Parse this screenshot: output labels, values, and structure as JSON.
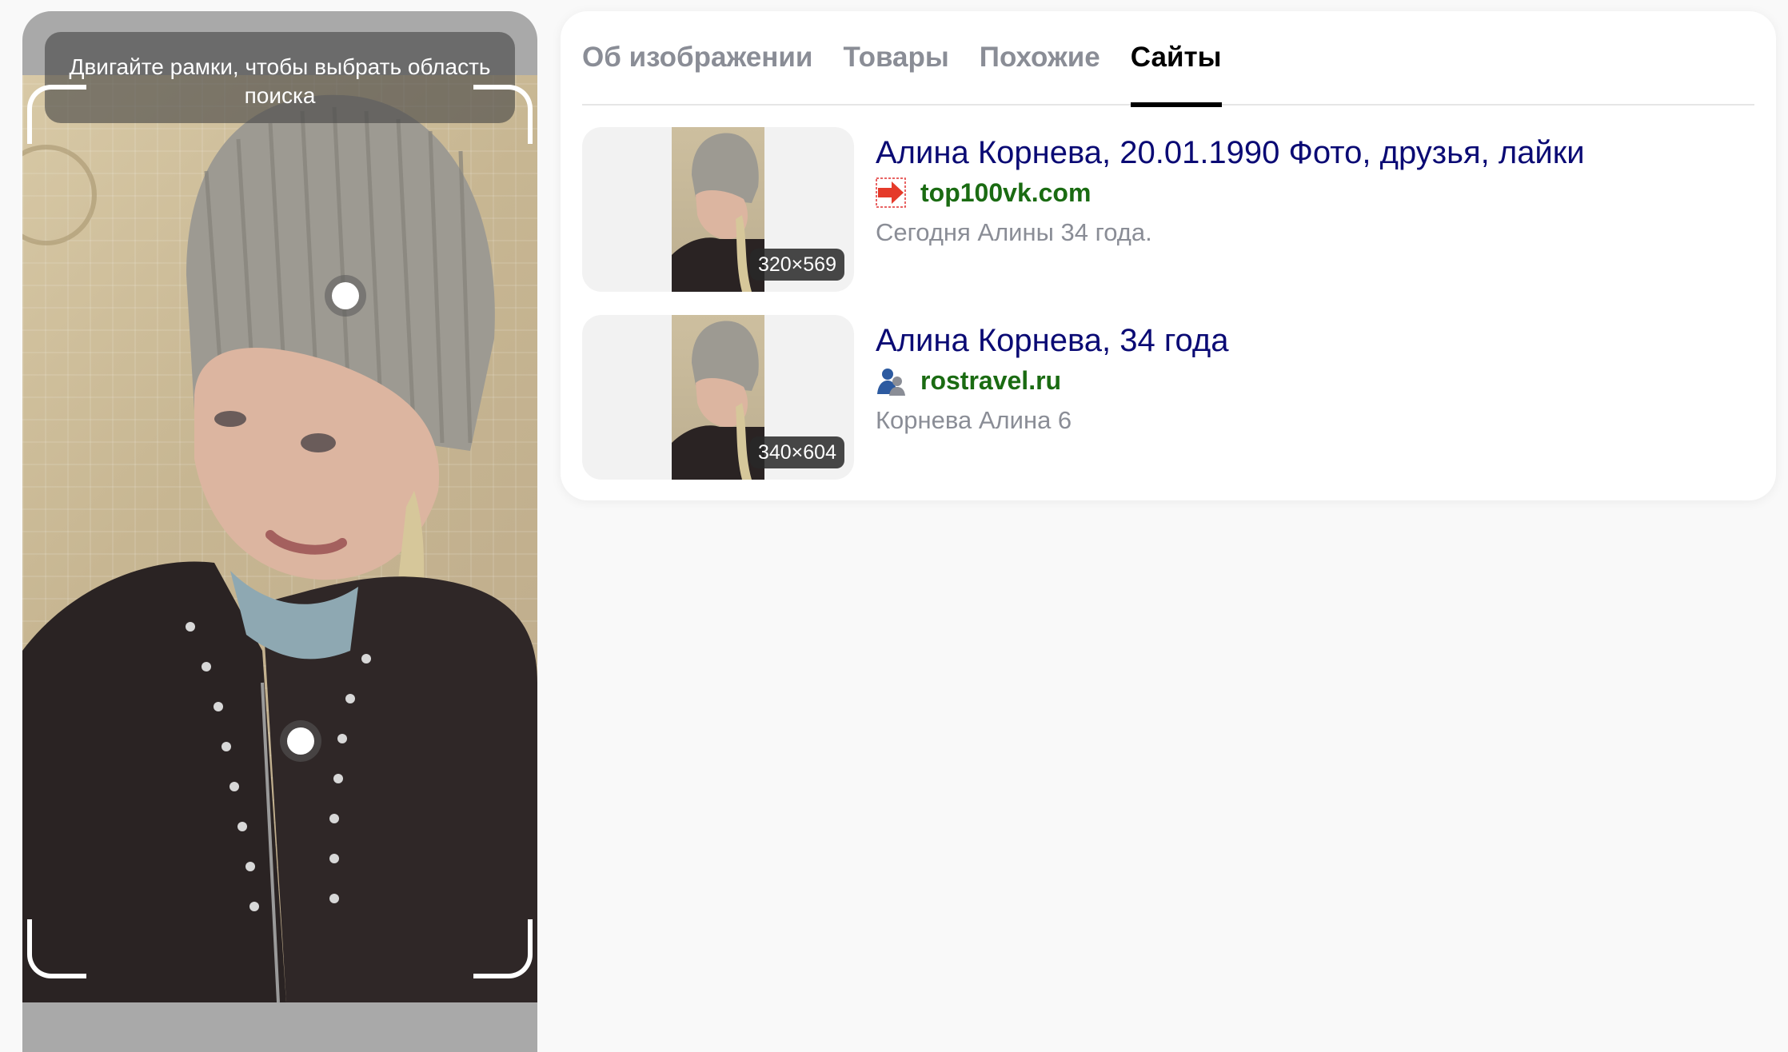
{
  "viewer": {
    "hint_text": "Двигайте рамки, чтобы выбрать область поиска"
  },
  "tabs": [
    {
      "label": "Об изображении",
      "active": false
    },
    {
      "label": "Товары",
      "active": false
    },
    {
      "label": "Похожие",
      "active": false
    },
    {
      "label": "Сайты",
      "active": true
    }
  ],
  "results": [
    {
      "title": "Алина Корнева, 20.01.1990 Фото, друзья, лайки",
      "site": "top100vk.com",
      "favicon": "red-arrow-icon",
      "description": "Сегодня Алины 34 года.",
      "image_size": "320×569"
    },
    {
      "title": "Алина Корнева, 34 года",
      "site": "rostravel.ru",
      "favicon": "people-icon",
      "description": "Корнева Алина 6",
      "image_size": "340×604"
    }
  ],
  "colors": {
    "title_link": "#0a0a74",
    "site_link": "#1a6b12",
    "tab_inactive": "#8a8d96",
    "tab_active": "#000000"
  }
}
